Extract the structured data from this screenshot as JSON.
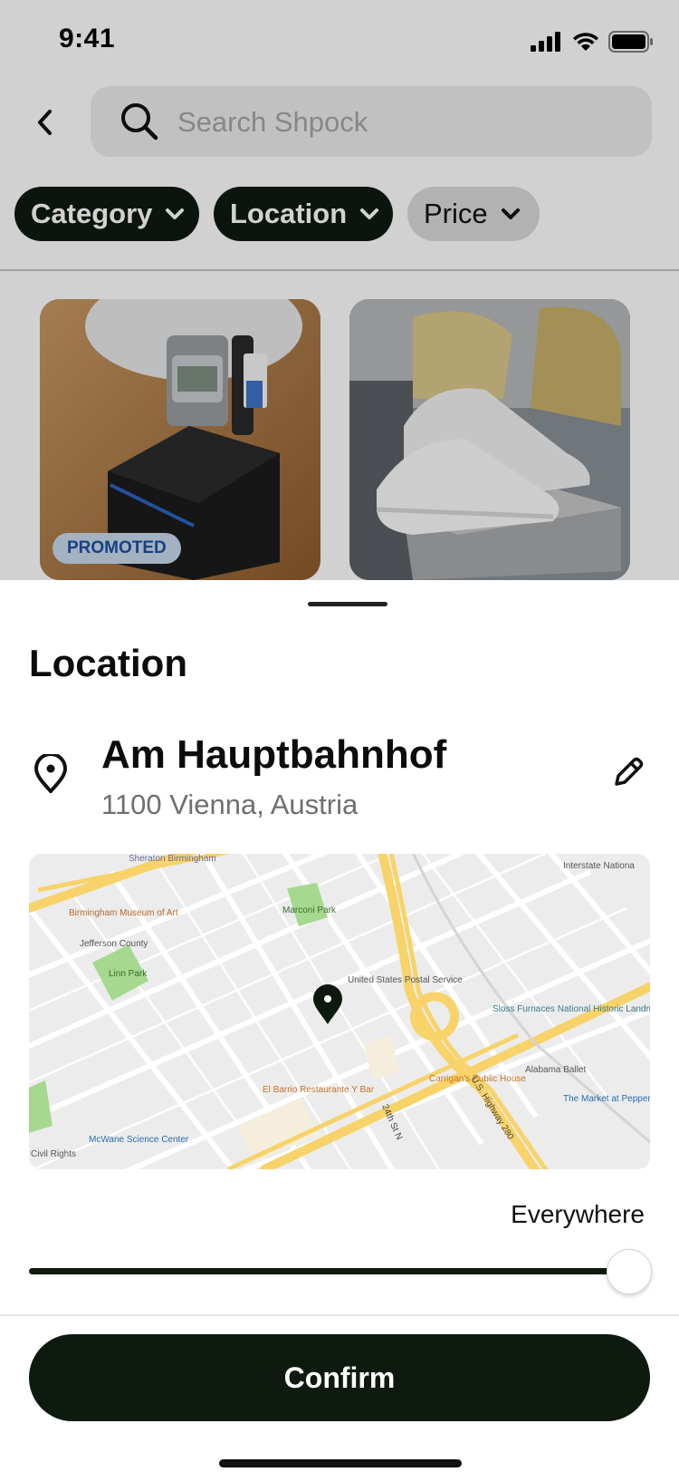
{
  "status_bar": {
    "time": "9:41"
  },
  "search": {
    "placeholder": "Search Shpock"
  },
  "filters": [
    {
      "label": "Category",
      "active": true
    },
    {
      "label": "Location",
      "active": true
    },
    {
      "label": "Price",
      "active": false
    }
  ],
  "products": [
    {
      "badge": "PROMOTED",
      "subject": "watch"
    },
    {
      "badge": "",
      "subject": "sneakers"
    }
  ],
  "sheet": {
    "title": "Location",
    "place_name": "Am Hauptbahnhof",
    "address": "1100 Vienna, Austria",
    "radius_label": "Everywhere",
    "radius_level": 1.0,
    "confirm_label": "Confirm"
  },
  "map": {
    "labels": {
      "sheraton": "Sheraton Birmingham",
      "museum": "Birmingham Museum of Art",
      "jefferson": "Jefferson County",
      "linn_park": "Linn Park",
      "marconi_park": "Marconi Park",
      "post_office": "United States Postal Service",
      "sloss": "Sloss Furnaces National Historic Landmark",
      "carrigan": "Carrigan's Public House",
      "alabama_ballet": "Alabama Ballet",
      "market": "The Market at Pepper Place",
      "el_barrio": "El Barrio Restaurante Y Bar",
      "mcwane": "McWane Science Center",
      "interstate": "Interstate Nationa",
      "civil_rights": "Civil Rights",
      "highway": "U.S. Highway 280",
      "ave_24th": "24th St N"
    }
  },
  "colors": {
    "primary_dark": "#0e1a10",
    "chip_light": "#dadada",
    "promo_bg": "#c7d9ec",
    "promo_text": "#1e4fa0"
  }
}
